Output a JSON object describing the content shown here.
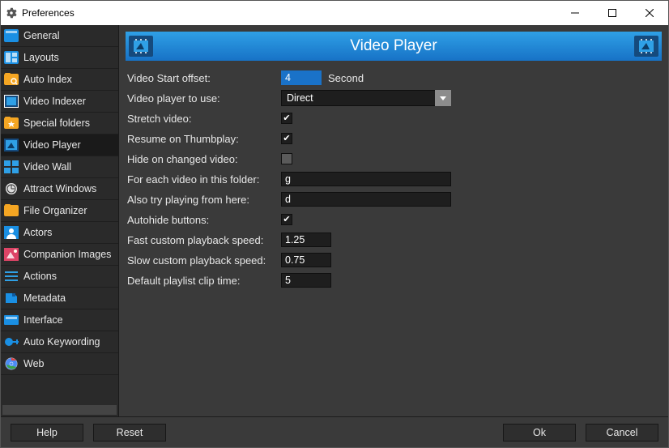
{
  "window": {
    "title": "Preferences"
  },
  "sidebar": {
    "items": [
      {
        "label": "General",
        "icon": "general"
      },
      {
        "label": "Layouts",
        "icon": "layouts"
      },
      {
        "label": "Auto Index",
        "icon": "autoindex"
      },
      {
        "label": "Video Indexer",
        "icon": "videoindexer"
      },
      {
        "label": "Special folders",
        "icon": "specialfolders"
      },
      {
        "label": "Video Player",
        "icon": "videoplayer"
      },
      {
        "label": "Video Wall",
        "icon": "videowall"
      },
      {
        "label": "Attract Windows",
        "icon": "attract"
      },
      {
        "label": "File Organizer",
        "icon": "fileorganizer"
      },
      {
        "label": "Actors",
        "icon": "actors"
      },
      {
        "label": "Companion Images",
        "icon": "companion"
      },
      {
        "label": "Actions",
        "icon": "actions"
      },
      {
        "label": "Metadata",
        "icon": "metadata"
      },
      {
        "label": "Interface",
        "icon": "interface"
      },
      {
        "label": "Auto Keywording",
        "icon": "autokeywording"
      },
      {
        "label": "Web",
        "icon": "web"
      }
    ],
    "selected_index": 5
  },
  "header": {
    "title": "Video Player"
  },
  "settings": {
    "video_start_offset": {
      "label": "Video Start offset:",
      "value": "4",
      "suffix": "Second"
    },
    "video_player_to_use": {
      "label": "Video player to use:",
      "value": "Direct"
    },
    "stretch_video": {
      "label": "Stretch video:",
      "checked": true
    },
    "resume_on_thumbplay": {
      "label": "Resume on Thumbplay:",
      "checked": true
    },
    "hide_on_changed_video": {
      "label": "Hide on changed video:",
      "checked": false
    },
    "for_each_video": {
      "label": "For each video in this folder:",
      "value": "g"
    },
    "also_try_playing": {
      "label": "Also try playing from here:",
      "value": "d"
    },
    "autohide_buttons": {
      "label": "Autohide buttons:",
      "checked": true
    },
    "fast_speed": {
      "label": "Fast custom playback speed:",
      "value": "1.25"
    },
    "slow_speed": {
      "label": "Slow custom playback speed:",
      "value": "0.75"
    },
    "default_clip_time": {
      "label": "Default playlist clip time:",
      "value": "5"
    }
  },
  "footer": {
    "help": "Help",
    "reset": "Reset",
    "ok": "Ok",
    "cancel": "Cancel"
  }
}
